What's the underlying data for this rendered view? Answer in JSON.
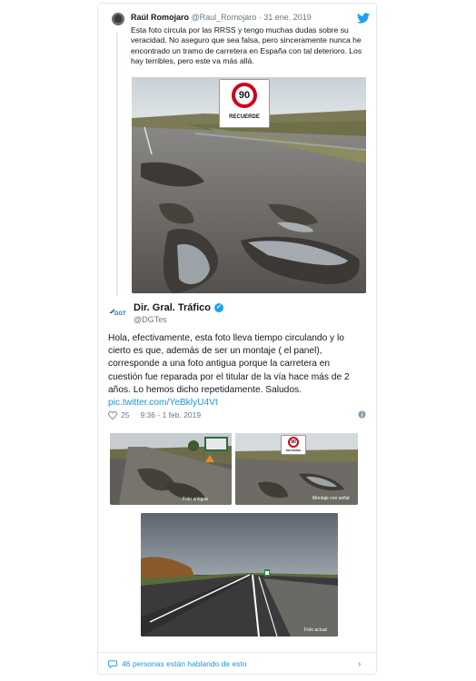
{
  "quoted_tweet": {
    "author_name": "Raúl Romojaro",
    "author_handle": "@Raul_Romojaro",
    "separator": " · ",
    "date": "31 ene. 2019",
    "text": "Esta foto circula por las RRSS y tengo muchas dudas sobre su veracidad. No aseguro que sea falsa, pero sinceramente nunca he encontrado un tramo de carretera en España con tal deterioro. Los hay terribles, pero este va más allá.",
    "sign_speed": "90",
    "sign_label": "RECUERDE"
  },
  "main_tweet": {
    "author_name": "Dir. Gral. Tráfico",
    "author_handle": "@DGTes",
    "logo_text": "DGT",
    "text": "Hola, efectivamente, esta foto lleva tiempo circulando y lo cierto es que, además de ser un montaje ( el panel), corresponde a una foto antigua porque la carretera en cuestión fue reparada por el titular de la vía hace más de 2 años. Lo hemos dicho repetidamente. Saludos.",
    "link": "pic.twitter.com/YeBklyU4Vt",
    "likes": "25",
    "time": "9:36 - 1 feb. 2019",
    "image_captions": [
      "Foto antigua",
      "Montaje con señal",
      "Foto actual"
    ],
    "small_sign_speed": "90",
    "small_sign_label": "RECUERDE"
  },
  "footer": {
    "conversation_text": "46 personas están hablando de esto"
  },
  "colors": {
    "twitter_blue": "#1da1f2",
    "link_blue": "#1b95e0",
    "muted": "#657786",
    "sign_red": "#d0021b"
  }
}
